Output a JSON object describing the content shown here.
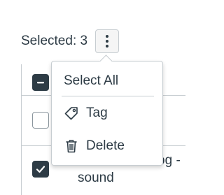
{
  "header": {
    "selected_label": "Selected: 3",
    "options_icon": "vertical-ellipsis-icon"
  },
  "rows": [
    {
      "checkbox_state": "indeterminate",
      "title": ""
    },
    {
      "checkbox_state": "unchecked",
      "title": ""
    },
    {
      "checkbox_state": "checked",
      "title_line1": "Canvas Catalog -",
      "title_line2": "sound"
    }
  ],
  "menu": {
    "items": [
      {
        "label": "Select All",
        "icon": ""
      },
      {
        "label": "Tag",
        "icon": "tag-icon"
      },
      {
        "label": "Delete",
        "icon": "trash-icon"
      }
    ]
  },
  "colors": {
    "text": "#2d3b45",
    "border": "#c7cdd1",
    "checkbox_fill": "#2d3b45",
    "button_bg": "#f5f5f5"
  }
}
